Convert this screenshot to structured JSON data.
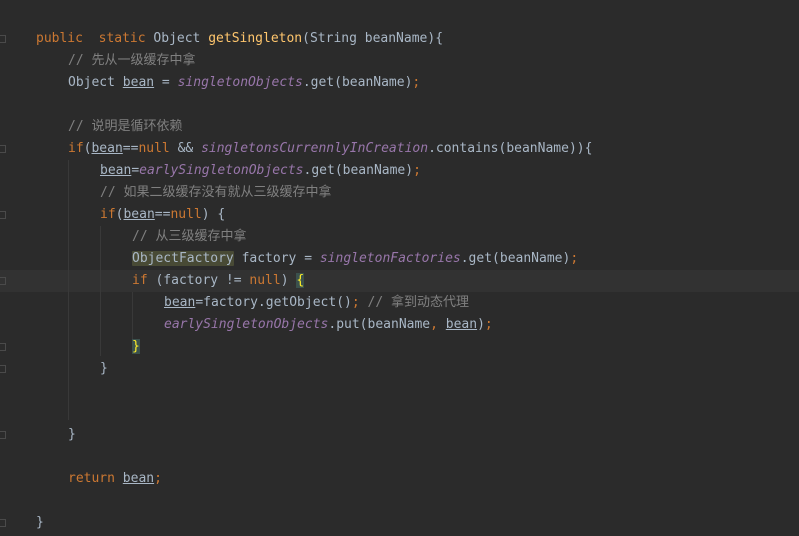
{
  "code": {
    "line1": {
      "kw1": "public",
      "kw2": "static",
      "type": "Object",
      "method": "getSingleton",
      "params": "(String beanName){"
    },
    "line2": {
      "comment": "// 先从一级缓存中拿"
    },
    "line3": {
      "type": "Object",
      "var": "bean",
      "eq": " = ",
      "field": "singletonObjects",
      "call": ".get(beanName)",
      "semi": ";"
    },
    "line5": {
      "comment": "// 说明是循环依赖"
    },
    "line6": {
      "kw": "if",
      "p1": "(",
      "var": "bean",
      "op1": "==",
      "nul": "null",
      "op2": " && ",
      "field": "singletonsCurrennlyInCreation",
      "call": ".contains(beanName)){"
    },
    "line7": {
      "var": "bean",
      "eq": "=",
      "field": "earlySingletonObjects",
      "call": ".get(beanName)",
      "semi": ";"
    },
    "line8": {
      "comment": "// 如果二级缓存没有就从三级缓存中拿"
    },
    "line9": {
      "kw": "if",
      "p1": "(",
      "var": "bean",
      "op": "==",
      "nul": "null",
      "rest": ") {"
    },
    "line10": {
      "comment": "// 从三级缓存中拿"
    },
    "line11": {
      "type": "ObjectFactory",
      "var": " factory = ",
      "field": "singletonFactories",
      "call": ".get(beanName)",
      "semi": ";"
    },
    "line12": {
      "kw": "if",
      "p1": " (factory != ",
      "nul": "null",
      "p2": ") ",
      "brace": "{"
    },
    "line13": {
      "var": "bean",
      "call": "=factory.getObject()",
      "semi": ";",
      "comment": " // 拿到动态代理"
    },
    "line14": {
      "field": "earlySingletonObjects",
      "call1": ".put(beanName",
      "comma": ",",
      "sp": " ",
      "var": "bean",
      "call2": ")",
      "semi": ";"
    },
    "line15": {
      "brace": "}"
    },
    "line16": {
      "brace": "}"
    },
    "line19": {
      "brace": "}"
    },
    "line21": {
      "kw": "return",
      "sp": " ",
      "var": "bean",
      "semi": ";"
    },
    "line23": {
      "brace": "}"
    }
  },
  "colors": {
    "background": "#2b2b2b",
    "keyword": "#cc7832",
    "method": "#ffc66d",
    "comment": "#808080",
    "field": "#9876aa",
    "text": "#a9b7c6"
  }
}
